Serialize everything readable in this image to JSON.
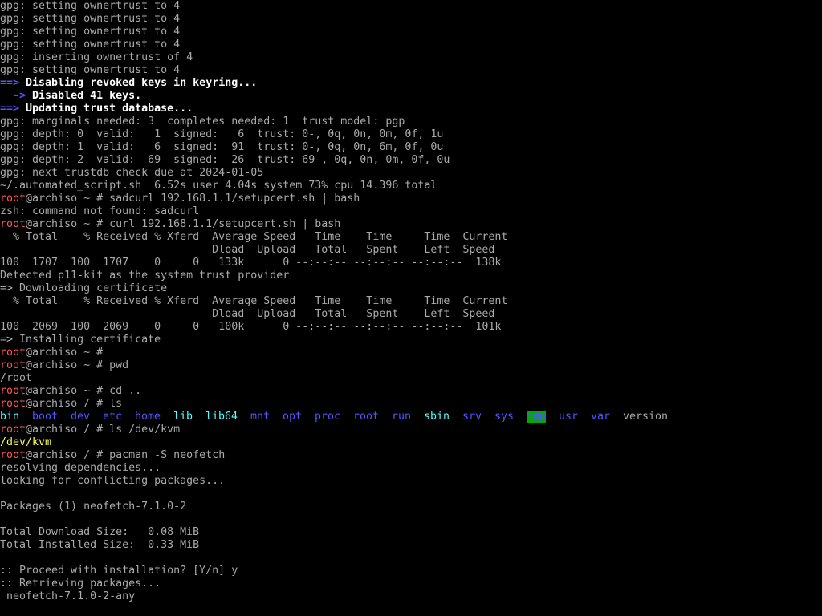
{
  "terminal": {
    "lines": [
      "gpg: setting ownertrust to 4",
      "gpg: setting ownertrust to 4",
      "gpg: setting ownertrust to 4",
      "gpg: setting ownertrust to 4",
      "gpg: inserting ownertrust of 4",
      "gpg: setting ownertrust to 4"
    ],
    "disabling": {
      "arrow": "==>",
      "text": " Disabling revoked keys in keyring..."
    },
    "disabled": {
      "arrow": "  ->",
      "text": " Disabled 41 keys."
    },
    "updating": {
      "arrow": "==>",
      "text": " Updating trust database..."
    },
    "gpg_lines": [
      "gpg: marginals needed: 3  completes needed: 1  trust model: pgp",
      "gpg: depth: 0  valid:   1  signed:   6  trust: 0-, 0q, 0n, 0m, 0f, 1u",
      "gpg: depth: 1  valid:   6  signed:  91  trust: 0-, 0q, 0n, 6m, 0f, 0u",
      "gpg: depth: 2  valid:  69  signed:  26  trust: 69-, 0q, 0n, 0m, 0f, 0u",
      "gpg: next trustdb check due at 2024-01-05",
      "~/.automated_script.sh  6.52s user 4.04s system 73% cpu 14.396 total"
    ],
    "prompt_user": "root",
    "prompt_host": "@archiso",
    "cmd1": " ~ # sadcurl 192.168.1.1/setupcert.sh | bash",
    "err1": "zsh: command not found: sadcurl",
    "cmd2": " ~ # curl 192.168.1.1/setupcert.sh | bash",
    "curl_header1": "  % Total    % Received % Xferd  Average Speed   Time    Time     Time  Current",
    "curl_header2": "                                 Dload  Upload   Total   Spent    Left  Speed",
    "curl_row1": "100  1707  100  1707    0     0   133k      0 --:--:-- --:--:-- --:--:--  138k",
    "detected": "Detected p11-kit as the system trust provider",
    "downloading": "=> Downloading certificate",
    "curl_header3": "  % Total    % Received % Xferd  Average Speed   Time    Time     Time  Current",
    "curl_header4": "                                 Dload  Upload   Total   Spent    Left  Speed",
    "curl_row2": "100  2069  100  2069    0     0   100k      0 --:--:-- --:--:-- --:--:--  101k",
    "installing": "=> Installing certificate",
    "cmd3": " ~ #",
    "cmd4": " ~ # pwd",
    "out_pwd": "/root",
    "cmd5": " ~ # cd ..",
    "cmd6": " / # ls",
    "ls_entries": [
      {
        "name": "bin",
        "color": "cyan"
      },
      {
        "name": "boot",
        "color": "blue"
      },
      {
        "name": "dev",
        "color": "blue"
      },
      {
        "name": "etc",
        "color": "blue"
      },
      {
        "name": "home",
        "color": "blue"
      },
      {
        "name": "lib",
        "color": "cyan"
      },
      {
        "name": "lib64",
        "color": "cyan"
      },
      {
        "name": "mnt",
        "color": "blue"
      },
      {
        "name": "opt",
        "color": "blue"
      },
      {
        "name": "proc",
        "color": "blue"
      },
      {
        "name": "root",
        "color": "blue"
      },
      {
        "name": "run",
        "color": "blue"
      },
      {
        "name": "sbin",
        "color": "cyan"
      },
      {
        "name": "srv",
        "color": "blue"
      },
      {
        "name": "sys",
        "color": "blue"
      },
      {
        "name": "tmp",
        "color": "sticky"
      },
      {
        "name": "usr",
        "color": "blue"
      },
      {
        "name": "var",
        "color": "blue"
      },
      {
        "name": "version",
        "color": "plain"
      }
    ],
    "cmd7": " / # ls /dev/kvm",
    "out_kvm": "/dev/kvm",
    "cmd8": " / # pacman -S neofetch",
    "resolving": "resolving dependencies...",
    "looking": "looking for conflicting packages...",
    "blank1": "",
    "packages": "Packages (1) neofetch-7.1.0-2",
    "blank2": "",
    "dl_size": "Total Download Size:   0.08 MiB",
    "inst_size": "Total Installed Size:  0.33 MiB",
    "blank3": "",
    "proceed": ":: Proceed with installation? [Y/n] y",
    "retrieving": ":: Retrieving packages...",
    "pkg": " neofetch-7.1.0-2-any"
  }
}
